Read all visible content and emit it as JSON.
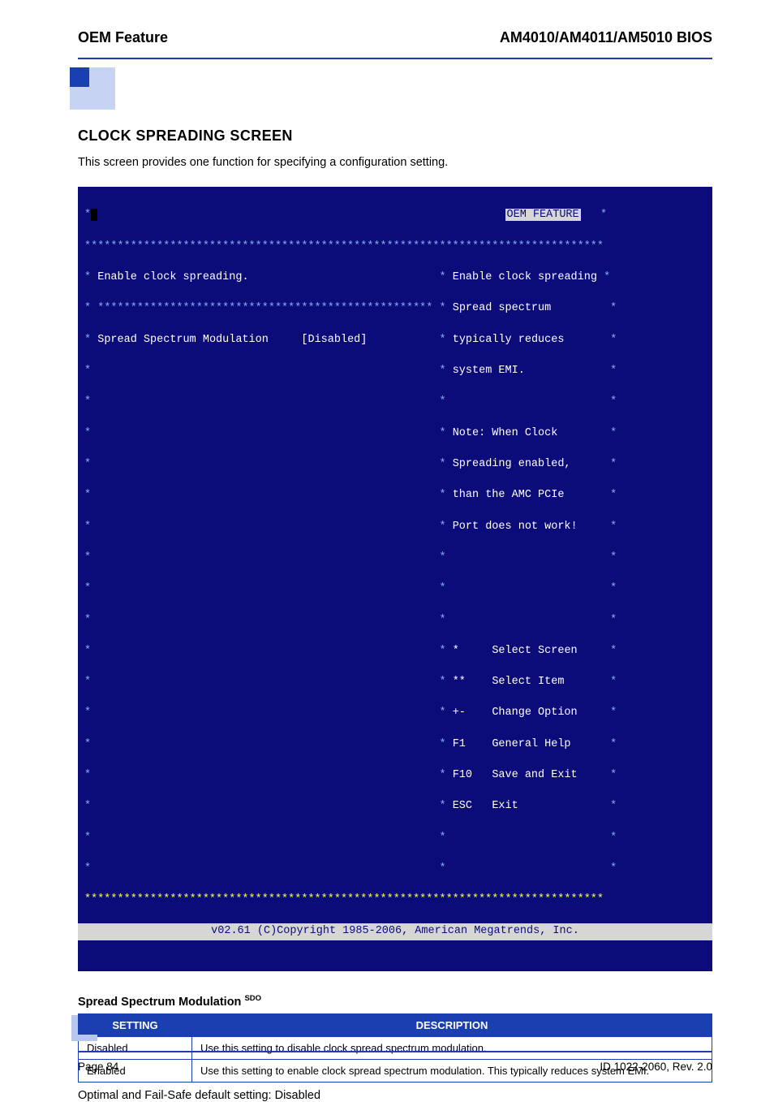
{
  "header": {
    "left": "OEM Feature",
    "right": "AM4010/AM4011/AM5010 BIOS"
  },
  "section_title": "CLOCK SPREADING SCREEN",
  "intro": "This screen provides one function for specifying a configuration setting.",
  "bios": {
    "badge": "OEM FEATURE",
    "left_title": "Enable clock spreading.",
    "option_label": "Spread Spectrum Modulation",
    "option_value": "[Disabled]",
    "help": {
      "l1": "Enable clock spreading",
      "l2": "Spread spectrum",
      "l3": "typically reduces",
      "l4": "system EMI.",
      "l5": "Note: When Clock",
      "l6": "Spreading enabled,",
      "l7": "than the AMC PCIe",
      "l8": "Port does not work!"
    },
    "keys": {
      "select_screen_sym": "*",
      "select_screen": "Select Screen",
      "select_item_sym": "**",
      "select_item": "Select Item",
      "change_sym": "+-",
      "change": "Change Option",
      "f1": "F1",
      "f1_label": "General Help",
      "f10": "F10",
      "f10_label": "Save and Exit",
      "esc": "ESC",
      "esc_label": "Exit"
    },
    "copyright": "v02.61 (C)Copyright 1985-2006, American Megatrends, Inc."
  },
  "subheading": "Spread Spectrum Modulation",
  "subheading_sup": "SDO",
  "table": {
    "h1": "SETTING",
    "h2": "DESCRIPTION",
    "rows": [
      {
        "setting": "Disabled",
        "desc": "Use this setting to disable clock spread spectrum modulation."
      },
      {
        "setting": "Enabled",
        "desc": "Use this setting to enable clock spread spectrum modulation. This typically reduces system EMI."
      }
    ]
  },
  "after_table": "Optimal and Fail-Safe default setting: Disabled",
  "footer": {
    "left": "Page 84",
    "right": "ID 1022-2060, Rev. 2.0"
  }
}
